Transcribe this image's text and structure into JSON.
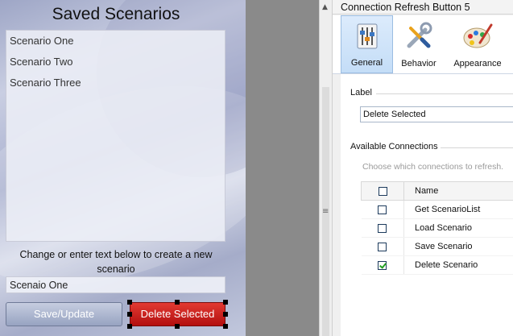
{
  "canvas": {
    "title": "Saved Scenarios",
    "scenarios": [
      "Scenario One",
      "Scenario Two",
      "Scenario Three"
    ],
    "instruction": "Change or enter text below to create a new scenario",
    "scenario_name_value": "Scenaio One",
    "save_label": "Save/Update",
    "delete_label": "Delete Selected"
  },
  "panel": {
    "title": "Connection Refresh Button 5",
    "tabs": [
      {
        "label": "General",
        "icon": "general-sliders-icon",
        "selected": true
      },
      {
        "label": "Behavior",
        "icon": "tools-icon",
        "selected": false
      },
      {
        "label": "Appearance",
        "icon": "palette-icon",
        "selected": false
      }
    ],
    "label_section": "Label",
    "label_value": "Delete Selected",
    "connections_section": "Available Connections",
    "connections_hint": "Choose which connections to refresh.",
    "table_header": "Name",
    "connections": [
      {
        "name": "Get ScenarioList",
        "checked": false
      },
      {
        "name": "Load Scenario",
        "checked": false
      },
      {
        "name": "Save Scenario",
        "checked": false
      },
      {
        "name": "Delete Scenario",
        "checked": true
      }
    ]
  },
  "colors": {
    "delete_button": "#c8201c",
    "save_button": "#a7b2cc",
    "tab_selected": "#c4ddf7"
  }
}
